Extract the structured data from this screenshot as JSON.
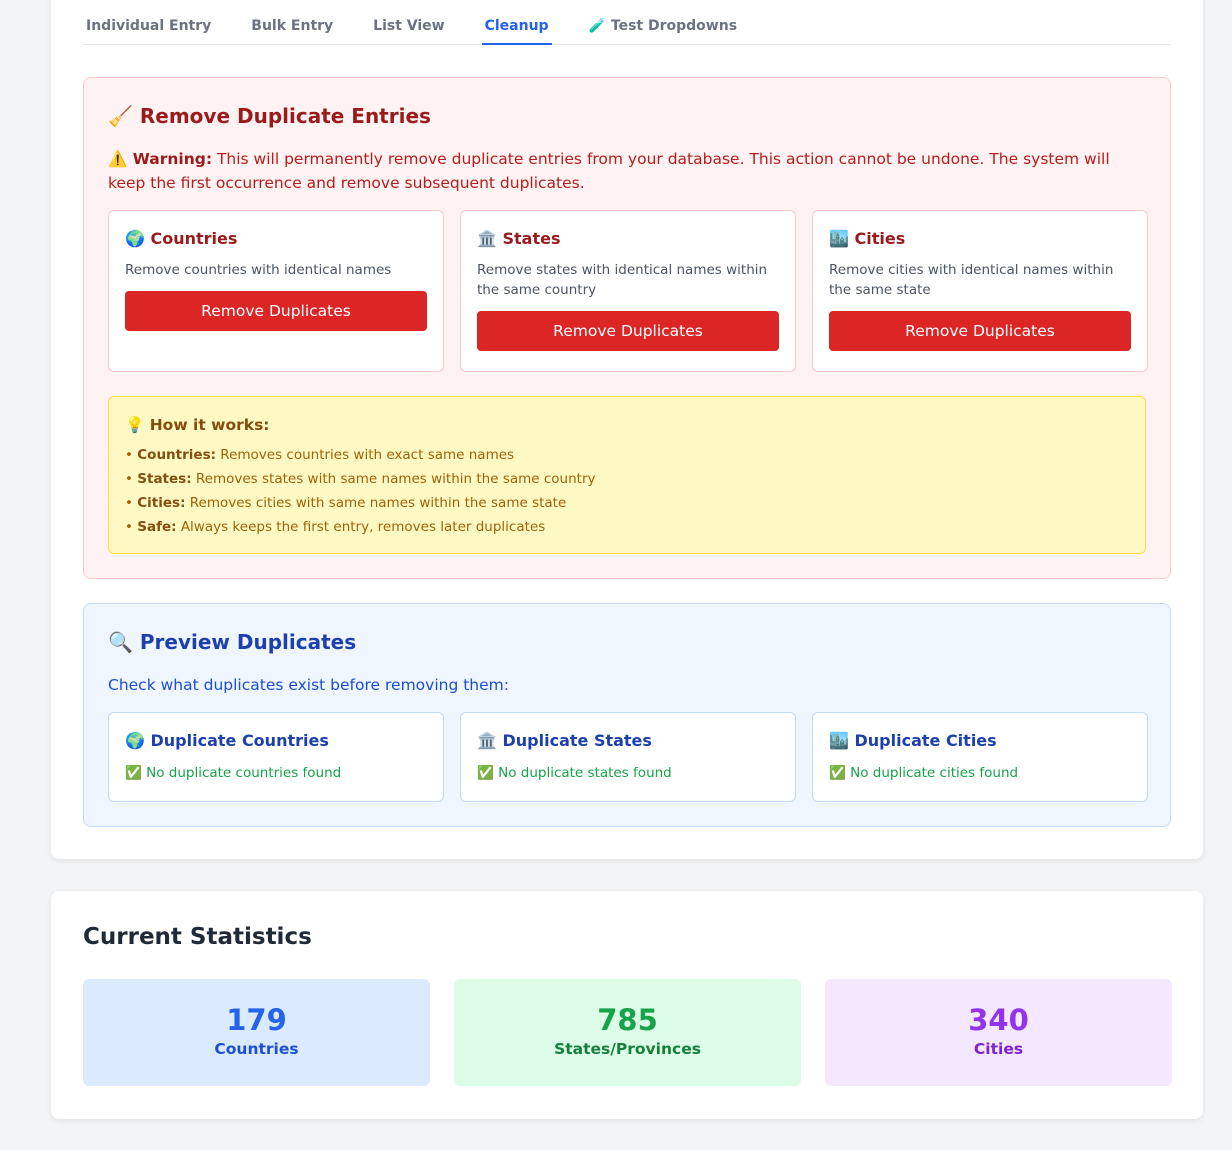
{
  "tabs": [
    {
      "label": "Individual Entry"
    },
    {
      "label": "Bulk Entry"
    },
    {
      "label": "List View"
    },
    {
      "label": "Cleanup"
    },
    {
      "label": "🧪 Test Dropdowns"
    }
  ],
  "remove_section": {
    "title": "🧹 Remove Duplicate Entries",
    "warning_label": "⚠️ Warning:",
    "warning_text": " This will permanently remove duplicate entries from your database. This action cannot be undone. The system will keep the first occurrence and remove subsequent duplicates.",
    "cards": [
      {
        "title": "🌍 Countries",
        "desc": "Remove countries with identical names",
        "button": "Remove Duplicates"
      },
      {
        "title": "🏛️ States",
        "desc": "Remove states with identical names within the same country",
        "button": "Remove Duplicates"
      },
      {
        "title": "🏙️ Cities",
        "desc": "Remove cities with identical names within the same state",
        "button": "Remove Duplicates"
      }
    ],
    "how": {
      "title": "💡 How it works:",
      "items": [
        {
          "bullet": "• ",
          "label": "Countries:",
          "text": " Removes countries with exact same names"
        },
        {
          "bullet": "• ",
          "label": "States:",
          "text": " Removes states with same names within the same country"
        },
        {
          "bullet": "• ",
          "label": "Cities:",
          "text": " Removes cities with same names within the same state"
        },
        {
          "bullet": "• ",
          "label": "Safe:",
          "text": " Always keeps the first entry, removes later duplicates"
        }
      ]
    }
  },
  "preview_section": {
    "title": "🔍 Preview Duplicates",
    "subtitle": "Check what duplicates exist before removing them:",
    "cards": [
      {
        "title": "🌍 Duplicate Countries",
        "status": "✅ No duplicate countries found"
      },
      {
        "title": "🏛️ Duplicate States",
        "status": "✅ No duplicate states found"
      },
      {
        "title": "🏙️ Duplicate Cities",
        "status": "✅ No duplicate cities found"
      }
    ]
  },
  "stats": {
    "title": "Current Statistics",
    "items": [
      {
        "value": "179",
        "label": "Countries"
      },
      {
        "value": "785",
        "label": "States/Provinces"
      },
      {
        "value": "340",
        "label": "Cities"
      }
    ]
  },
  "colors": {
    "accent": "#2563eb",
    "danger": "#dc2626",
    "success": "#16a34a",
    "purple": "#9333ea"
  }
}
